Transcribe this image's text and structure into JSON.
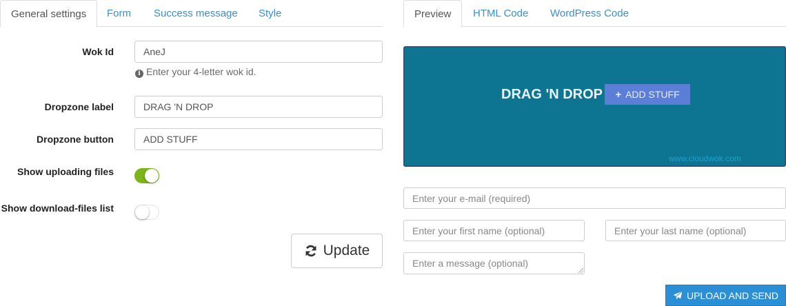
{
  "left_tabs": [
    "General settings",
    "Form",
    "Success message",
    "Style"
  ],
  "right_tabs": [
    "Preview",
    "HTML Code",
    "WordPress Code"
  ],
  "settings": {
    "wok_id": {
      "label": "Wok Id",
      "value": "AneJ",
      "help": "Enter your 4-letter wok id."
    },
    "dropzone_label": {
      "label": "Dropzone label",
      "value": "DRAG 'N DROP"
    },
    "dropzone_button": {
      "label": "Dropzone button",
      "value": "ADD STUFF"
    },
    "show_uploading_files": {
      "label": "Show uploading files",
      "on": true
    },
    "show_download_list": {
      "label": "Show download-files list",
      "on": false
    },
    "update_label": "Update"
  },
  "preview": {
    "dropzone_label": "DRAG 'N DROP",
    "dropzone_button": "ADD STUFF",
    "footer": "www.cloudwok.com",
    "email_placeholder": "Enter your e-mail (required)",
    "first_name_placeholder": "Enter your first name (optional)",
    "last_name_placeholder": "Enter your last name (optional)",
    "message_placeholder": "Enter a message (optional)",
    "upload_label": "UPLOAD AND SEND"
  },
  "colors": {
    "accent_link": "#3a8fd0",
    "toggle_on": "#7cb518",
    "dropzone_bg": "#0d7592",
    "dropzone_button": "#5b7fd6",
    "upload_button": "#2b8fd5"
  },
  "icons": [
    "info-icon",
    "refresh-icon",
    "plus-icon",
    "paper-plane-icon"
  ]
}
